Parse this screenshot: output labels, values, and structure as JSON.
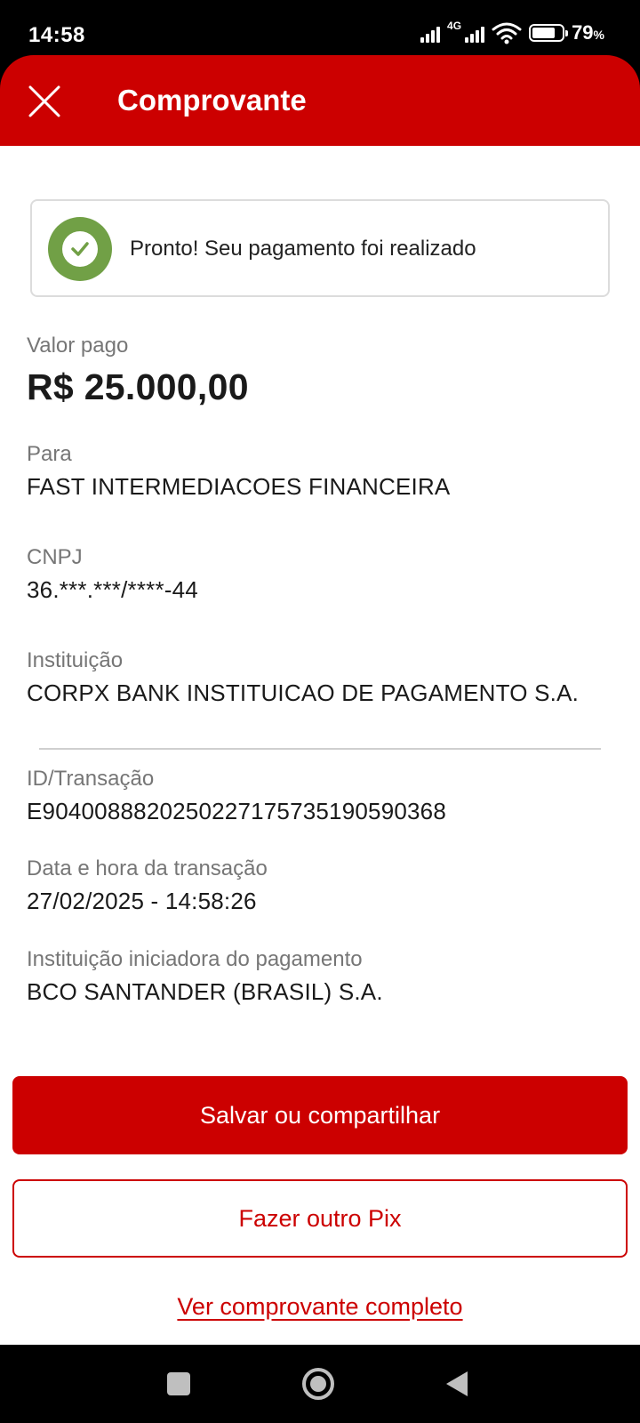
{
  "status_bar": {
    "time": "14:58",
    "network": "4G",
    "battery_percent": "79",
    "battery_unit": "%",
    "battery_level": 0.79,
    "icons": [
      "signal-icon",
      "signal-4g-icon",
      "wifi-icon",
      "battery-icon"
    ]
  },
  "header": {
    "title": "Comprovante",
    "close_icon": "close-icon",
    "background_color": "#cc0000"
  },
  "success": {
    "message": "Pronto! Seu pagamento foi realizado",
    "icon": "check-circle-icon",
    "icon_color": "#71a046"
  },
  "payment": {
    "amount_label": "Valor pago",
    "amount_value": "R$ 25.000,00",
    "recipient_label": "Para",
    "recipient_value": "FAST INTERMEDIACOES FINANCEIRA",
    "cnpj_label": "CNPJ",
    "cnpj_value": "36.***.***/****-44",
    "institution_label": "Instituição",
    "institution_value": "CORPX BANK INSTITUICAO DE PAGAMENTO S.A.",
    "transaction_id_label": "ID/Transação",
    "transaction_id_value": "E90400888202502271757351905903 68",
    "datetime_label": "Data e hora da transação",
    "datetime_value": "27/02/2025 - 14:58:26",
    "initiator_label": "Instituição iniciadora do pagamento",
    "initiator_value": "BCO SANTANDER (BRASIL) S.A."
  },
  "actions": {
    "save_share_label": "Salvar ou compartilhar",
    "another_pix_label": "Fazer outro Pix",
    "full_receipt_label": "Ver comprovante completo"
  },
  "nav_bar": {
    "icons": [
      "recents-icon",
      "home-icon",
      "back-icon"
    ]
  }
}
